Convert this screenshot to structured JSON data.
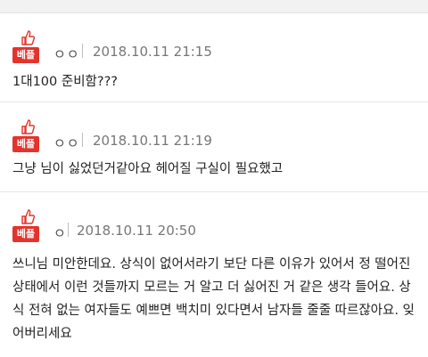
{
  "comments": [
    {
      "badge": "베플",
      "user": "ㅇㅇ",
      "date": "2018.10.11 21:15",
      "text": "1대100 준비함???"
    },
    {
      "badge": "베플",
      "user": "ㅇㅇ",
      "date": "2018.10.11 21:19",
      "text": "그냥 님이 싫었던거같아요 헤어질 구실이 필요했고"
    },
    {
      "badge": "베플",
      "user": "ㅇ",
      "date": "2018.10.11 20:50",
      "text": "쓰니님 미안한데요. 상식이 없어서라기 보단 다른 이유가 있어서 정 떨어진 상태에서 이런 것들까지 모르는 거 알고 더 싫어진 거 같은 생각 들어요. 상식 전혀 없는 여자들도 예쁘면 백치미 있다면서 남자들 줄줄 따르잖아요. 잊어버리세요"
    }
  ],
  "colors": {
    "badge": "#e4332d",
    "thumb": "#e4332d"
  },
  "icons": {
    "badge_icon": "thumbs-up-icon"
  }
}
